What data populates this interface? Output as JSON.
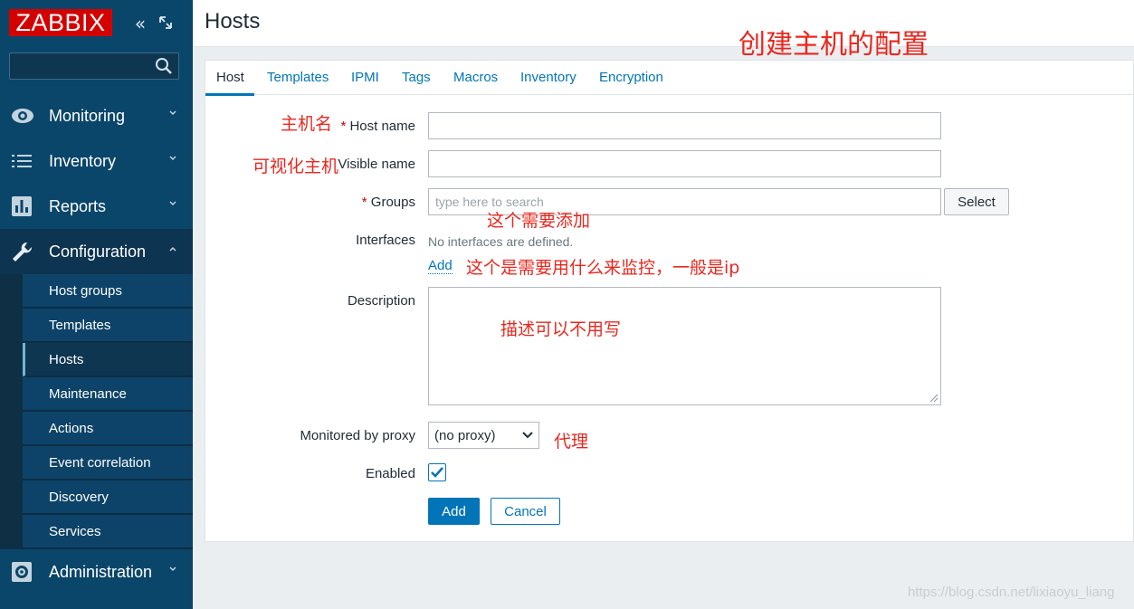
{
  "app": {
    "logo_text": "ZABBIX",
    "colors": {
      "sidebar": "#0a466a",
      "accent": "#0275b8",
      "logo": "#d40000",
      "note": "#e8281f"
    }
  },
  "sidebar": {
    "collapse_icon": "double-chevron-left-icon",
    "kiosk_icon": "expand-icon",
    "search": {
      "placeholder": "",
      "value": ""
    },
    "menu": [
      {
        "label": "Monitoring",
        "icon": "eye-icon"
      },
      {
        "label": "Inventory",
        "icon": "list-icon"
      },
      {
        "label": "Reports",
        "icon": "bar-chart-icon"
      },
      {
        "label": "Configuration",
        "icon": "wrench-icon"
      },
      {
        "label": "Administration",
        "icon": "gear-icon"
      }
    ],
    "submenu": [
      {
        "label": "Host groups"
      },
      {
        "label": "Templates"
      },
      {
        "label": "Hosts"
      },
      {
        "label": "Maintenance"
      },
      {
        "label": "Actions"
      },
      {
        "label": "Event correlation"
      },
      {
        "label": "Discovery"
      },
      {
        "label": "Services"
      }
    ]
  },
  "page": {
    "title": "Hosts"
  },
  "tabs": [
    "Host",
    "Templates",
    "IPMI",
    "Tags",
    "Macros",
    "Inventory",
    "Encryption"
  ],
  "form": {
    "host_name_label": "Host name",
    "visible_name_label": "Visible name",
    "groups_label": "Groups",
    "groups_placeholder": "type here to search",
    "select_button": "Select",
    "interfaces_label": "Interfaces",
    "no_interfaces": "No interfaces are defined.",
    "add_link": "Add",
    "description_label": "Description",
    "proxy_label": "Monitored by proxy",
    "proxy_value": "(no proxy)",
    "enabled_label": "Enabled",
    "enabled": true,
    "add_button": "Add",
    "cancel_button": "Cancel",
    "required_mark": "*"
  },
  "annotations": {
    "title": "创建主机的配置",
    "host_name": "主机名",
    "visible_name": "可视化主机",
    "groups": "这个需要添加",
    "interfaces": "这个是需要用什么来监控，一般是ip",
    "description": "描述可以不用写",
    "proxy": "代理"
  },
  "watermark": "https://blog.csdn.net/lixiaoyu_liang"
}
